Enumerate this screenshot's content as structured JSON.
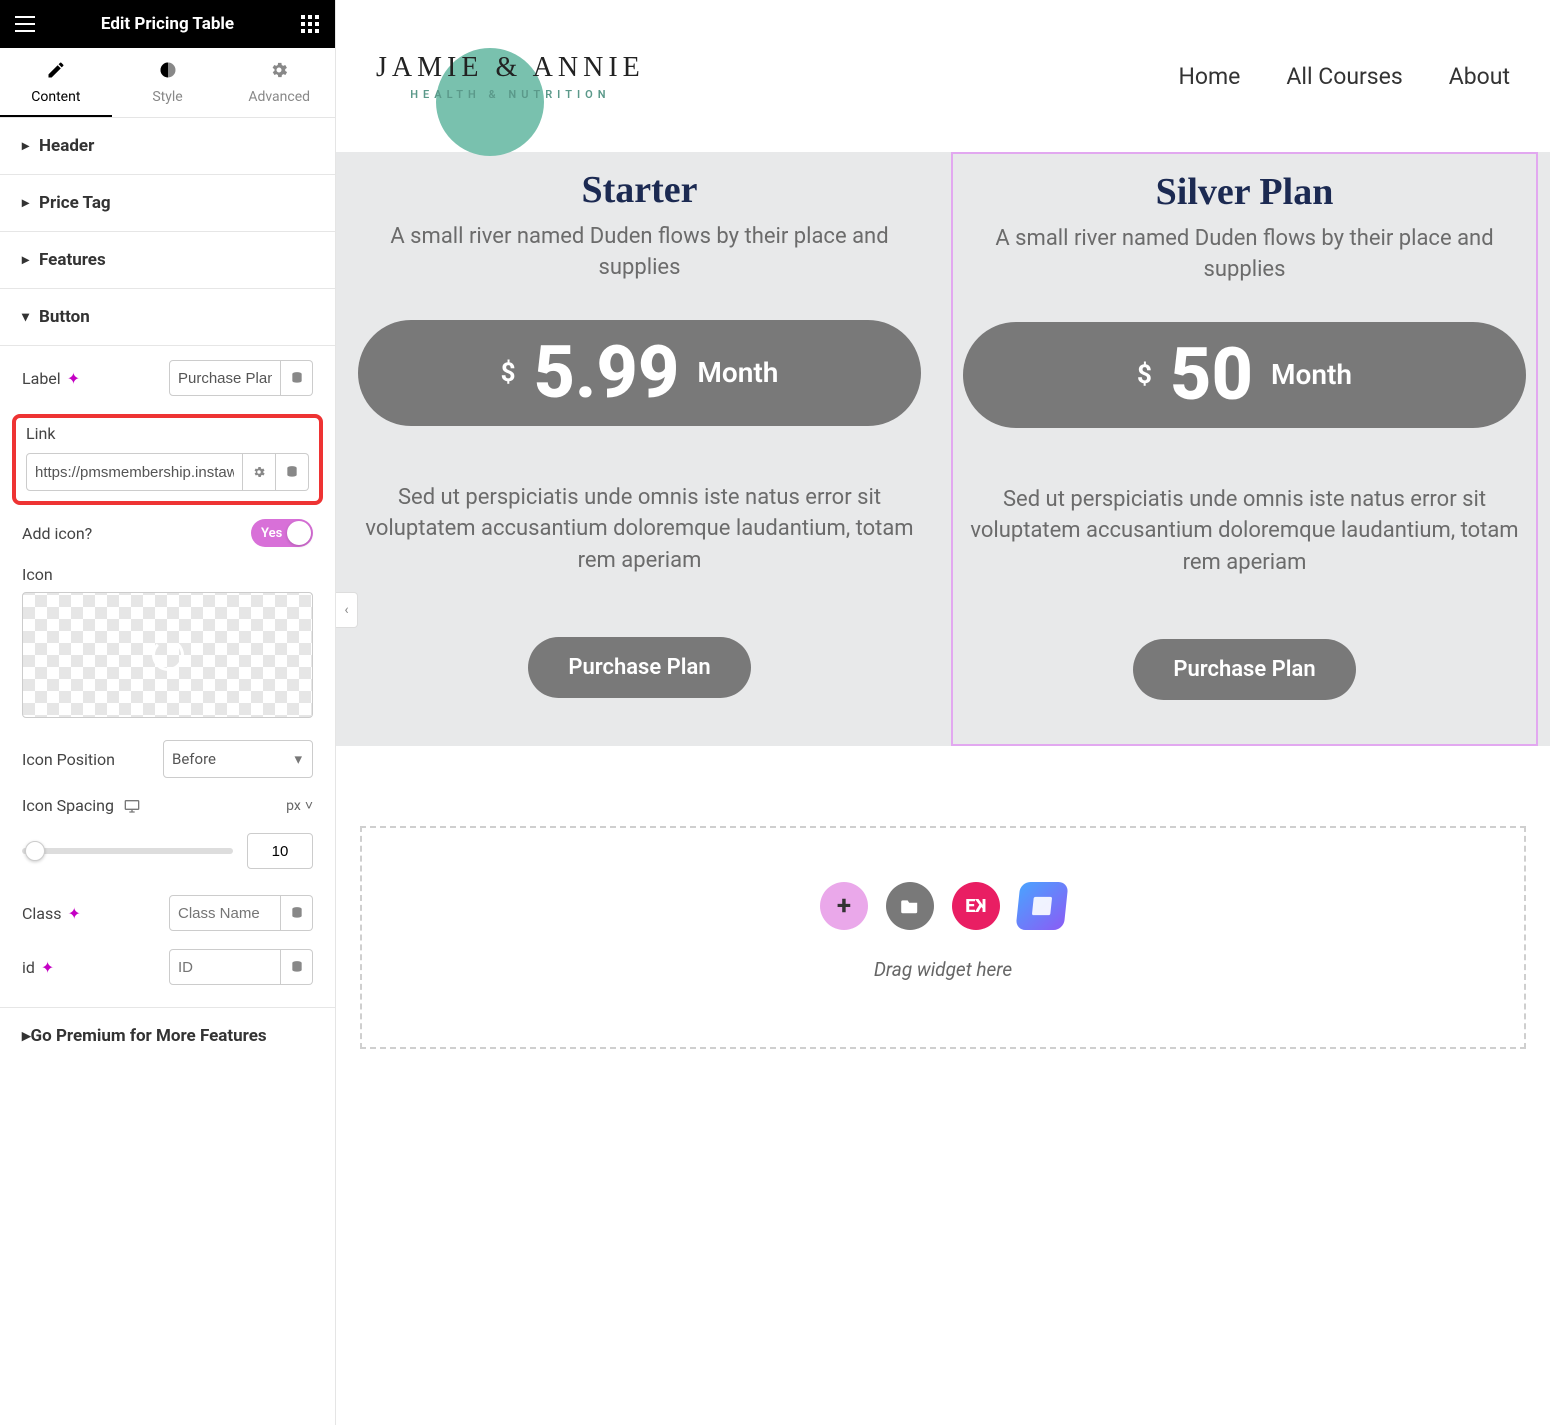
{
  "panel": {
    "title": "Edit Pricing Table",
    "tabs": {
      "content": "Content",
      "style": "Style",
      "advanced": "Advanced"
    },
    "sections": {
      "header": "Header",
      "priceTag": "Price Tag",
      "features": "Features",
      "button": "Button",
      "premium": "Go Premium for More Features"
    },
    "button": {
      "label_title": "Label",
      "label_value": "Purchase Plan",
      "link_title": "Link",
      "link_value": "https://pmsmembership.instawp.x",
      "addicon_title": "Add icon?",
      "addicon_value": "Yes",
      "icon_title": "Icon",
      "icon_position_title": "Icon Position",
      "icon_position_value": "Before",
      "icon_spacing_title": "Icon Spacing",
      "icon_spacing_unit": "px",
      "icon_spacing_value": "10",
      "class_title": "Class",
      "class_placeholder": "Class Name",
      "id_title": "id",
      "id_placeholder": "ID"
    }
  },
  "site": {
    "brand": "JAMIE & ANNIE",
    "tagline": "HEALTH & NUTRITION",
    "nav": {
      "home": "Home",
      "courses": "All Courses",
      "about": "About"
    }
  },
  "plans": [
    {
      "title": "Starter",
      "subtitle": "A small river named Duden flows by their place and supplies",
      "currency": "$",
      "amount": "5.99",
      "period": "Month",
      "desc": "Sed ut perspiciatis unde omnis iste natus error sit voluptatem accusantium doloremque laudantium, totam rem aperiam",
      "cta": "Purchase Plan"
    },
    {
      "title": "Silver Plan",
      "subtitle": "A small river named Duden flows by their place and supplies",
      "currency": "$",
      "amount": "50",
      "period": "Month",
      "desc": "Sed ut perspiciatis unde omnis iste natus error sit voluptatem accusantium doloremque laudantium, totam rem aperiam",
      "cta": "Purchase Plan"
    }
  ],
  "dropzone": {
    "text": "Drag widget here"
  }
}
